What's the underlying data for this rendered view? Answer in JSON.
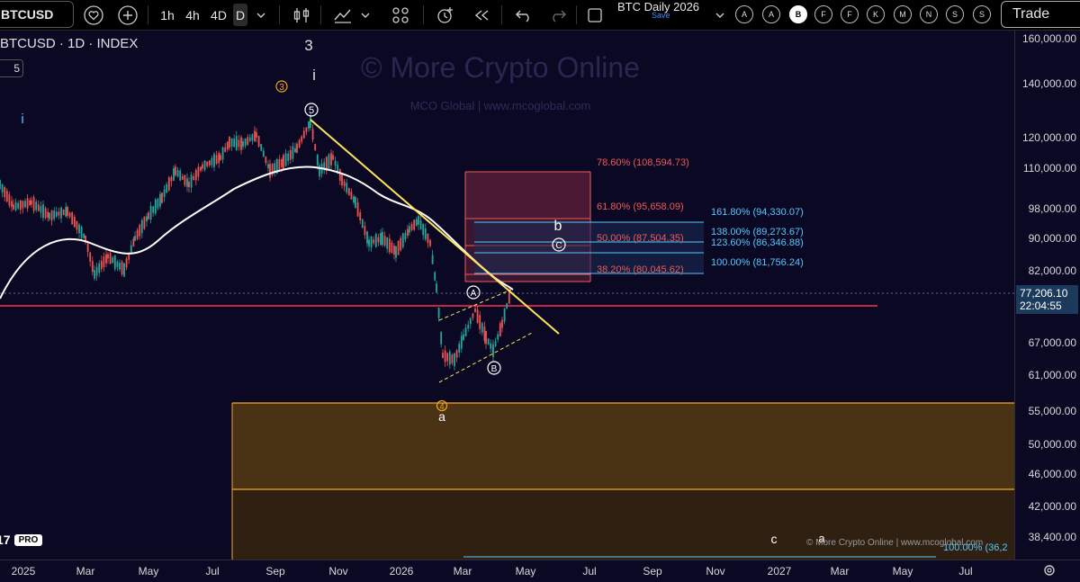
{
  "toolbar": {
    "symbol": "BTCUSD",
    "intervals": [
      "1h",
      "4h",
      "4D",
      "D"
    ],
    "active_interval": "D",
    "layout_title": "BTC Daily 2026",
    "layout_save": "Save",
    "drawing_buttons": [
      "A",
      "A",
      "B",
      "F",
      "F",
      "K",
      "M",
      "N",
      "S"
    ],
    "active_drawing_button": "B",
    "trade_label": "Trade",
    "icons": [
      "heart-icon",
      "plus-icon",
      "chevron-down-icon",
      "candles-icon",
      "indicators-icon",
      "templates-icon",
      "alert-icon",
      "replay-icon",
      "undo-icon",
      "redo-icon",
      "square-icon"
    ]
  },
  "chart": {
    "symbol_title": "BTCUSD · 1D · INDEX",
    "indicator_count": "5",
    "watermark_main": "© More Crypto Online",
    "watermark_sub": "MCO Global  |  www.mcoglobal.com",
    "watermark_bottom": "© More Crypto Online  |  www.mcoglobal.com",
    "current_price": "77,206.10",
    "countdown": "22:04:55",
    "logo_text": "PRO",
    "colors": {
      "background": "#0b0824",
      "red_fib": "#f05a5a",
      "blue_fib": "#56c8ff",
      "orange_zone": "#f5a623",
      "trendline": "#ffe45a",
      "moving_average": "#ffffff",
      "candle_up": "#26a69a",
      "candle_down": "#ef5350"
    },
    "price_axis_labels": [
      "160,000.00",
      "140,000.00",
      "120,000.00",
      "110,000.00",
      "98,000.00",
      "90,000.00",
      "82,000.00",
      "67,000.00",
      "61,000.00",
      "55,000.00",
      "50,000.00",
      "46,000.00",
      "42,000.00",
      "38,400.00"
    ],
    "time_axis_labels": [
      "2025",
      "Mar",
      "May",
      "Jul",
      "Sep",
      "Nov",
      "2026",
      "Mar",
      "May",
      "Jul",
      "Sep",
      "Nov",
      "2027",
      "Mar",
      "May",
      "Jul"
    ],
    "fib_red": [
      {
        "label": "78.60% (108,594.73)"
      },
      {
        "label": "61.80% (95,658.09)"
      },
      {
        "label": "50.00% (87,504.35)"
      },
      {
        "label": "38.20% (80,045.62)"
      }
    ],
    "fib_blue": [
      {
        "label": "161.80% (94,330.07)"
      },
      {
        "label": "138.00% (89,273.67)"
      },
      {
        "label": "123.60% (86,346.88)"
      },
      {
        "label": "100.00% (81,756.24)"
      }
    ],
    "fib_bottom": "100.00% (36,2",
    "wave_labels": {
      "three_top": "3",
      "i_top": "i",
      "circle3": "3",
      "circle5": "5",
      "i_left": "i",
      "b": "b",
      "cC": "C",
      "cA": "A",
      "cB": "B",
      "circle4": "4",
      "a_lower": "a",
      "c_bottom": "c",
      "a_bottom": "a"
    }
  }
}
